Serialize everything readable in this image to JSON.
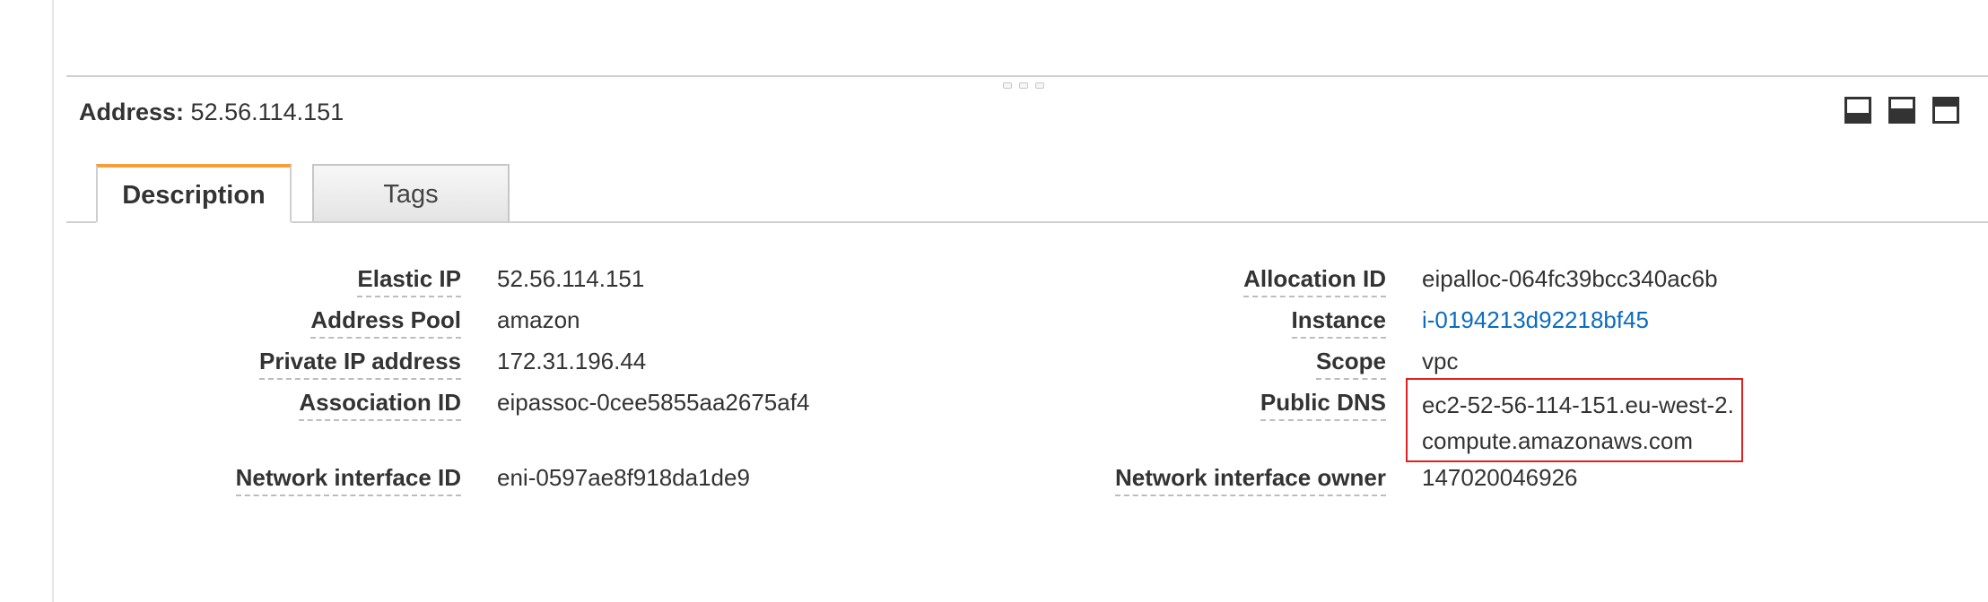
{
  "header": {
    "address_label": "Address:",
    "address_value": "52.56.114.151"
  },
  "panel_controls": [
    "minimize-panel-icon",
    "split-panel-icon",
    "maximize-panel-icon"
  ],
  "tabs": [
    {
      "label": "Description",
      "active": true
    },
    {
      "label": "Tags",
      "active": false
    }
  ],
  "details": {
    "elastic_ip": {
      "label": "Elastic IP",
      "value": "52.56.114.151"
    },
    "address_pool": {
      "label": "Address Pool",
      "value": "amazon"
    },
    "private_ip": {
      "label": "Private IP address",
      "value": "172.31.196.44"
    },
    "association_id": {
      "label": "Association ID",
      "value": "eipassoc-0cee5855aa2675af4"
    },
    "network_interface_id": {
      "label": "Network interface ID",
      "value": "eni-0597ae8f918da1de9"
    },
    "allocation_id": {
      "label": "Allocation ID",
      "value": "eipalloc-064fc39bcc340ac6b"
    },
    "instance": {
      "label": "Instance",
      "value": "i-0194213d92218bf45"
    },
    "scope": {
      "label": "Scope",
      "value": "vpc"
    },
    "public_dns": {
      "label": "Public DNS",
      "value": "ec2-52-56-114-151.eu-west-2.compute.amazonaws.com"
    },
    "network_interface_owner": {
      "label": "Network interface owner",
      "value": "147020046926"
    }
  },
  "colors": {
    "tab_accent": "#f3a03a",
    "link": "#0b6cbf",
    "highlight_box": "#e02020"
  }
}
